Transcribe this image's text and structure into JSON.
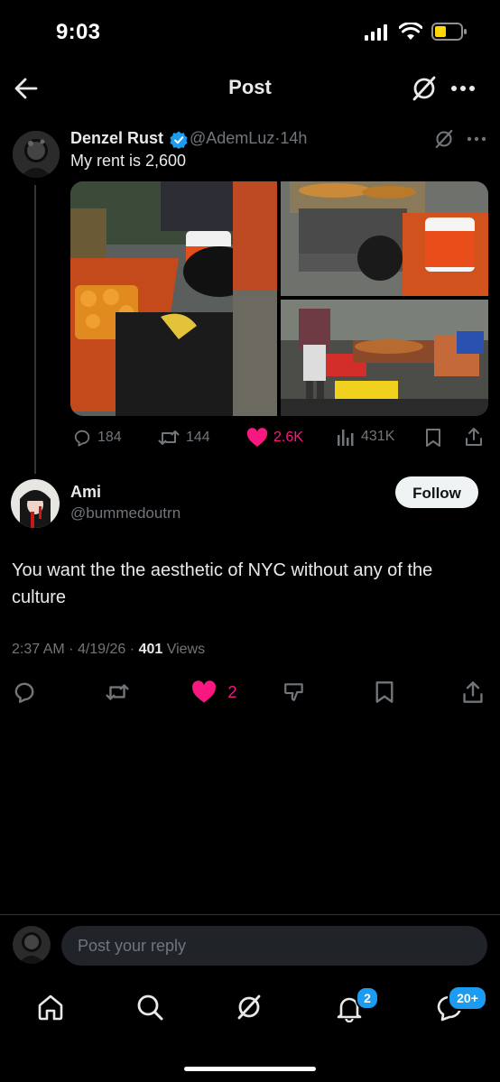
{
  "status_bar": {
    "time": "9:03"
  },
  "header": {
    "title": "Post"
  },
  "parent_post": {
    "author_name": "Denzel Rust",
    "handle": "@AdemLuz",
    "separator": "·",
    "age": "14h",
    "text": "My rent is 2,600",
    "actions": {
      "replies": "184",
      "reposts": "144",
      "likes": "2.6K",
      "views": "431K"
    }
  },
  "reply": {
    "author_name": "Ami",
    "handle": "@bummedoutrn",
    "follow_label": "Follow",
    "text": "You want the the aesthetic of NYC without any of the culture",
    "time": "2:37 AM",
    "date": "4/19/26",
    "meta_sep": "·",
    "views_count": "401",
    "views_label": "Views",
    "likes": "2"
  },
  "composer": {
    "placeholder": "Post your reply"
  },
  "bottom_nav": {
    "notifications_badge": "2",
    "messages_badge": "20+"
  },
  "colors": {
    "accent": "#1d9bf0",
    "like": "#f91880",
    "muted": "#71767b",
    "background": "#000000"
  }
}
